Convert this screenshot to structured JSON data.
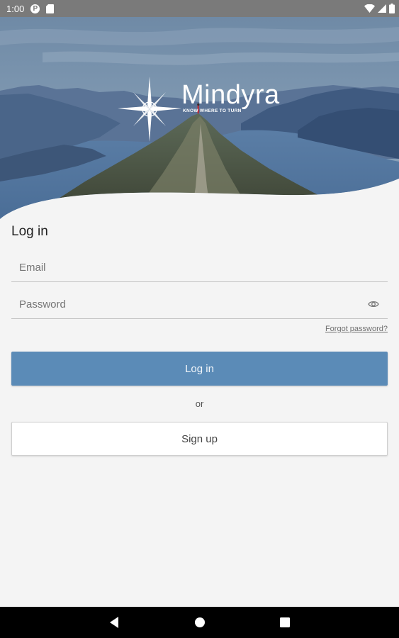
{
  "status_bar": {
    "time": "1:00",
    "badge_letter": "P",
    "icons": [
      "p-badge-icon",
      "sd-card-icon",
      "wifi-icon",
      "signal-icon",
      "battery-icon"
    ]
  },
  "logo": {
    "wordmark": "Mindyra",
    "tagline": "KNOW WHERE TO TURN",
    "icon": "compass-star-icon"
  },
  "login_form": {
    "title": "Log in",
    "email_placeholder": "Email",
    "password_placeholder": "Password",
    "password_toggle_icon": "eye-icon",
    "forgot_password": "Forgot password?",
    "login_button": "Log in",
    "divider_text": "or",
    "signup_button": "Sign up"
  },
  "nav_bar": {
    "icons": [
      "back-icon",
      "home-icon",
      "recents-icon"
    ]
  },
  "colors": {
    "primary_button": "#5b8bb7",
    "background": "#f4f4f4",
    "status_bar": "#7a7a7a",
    "nav_bar": "#000000"
  }
}
